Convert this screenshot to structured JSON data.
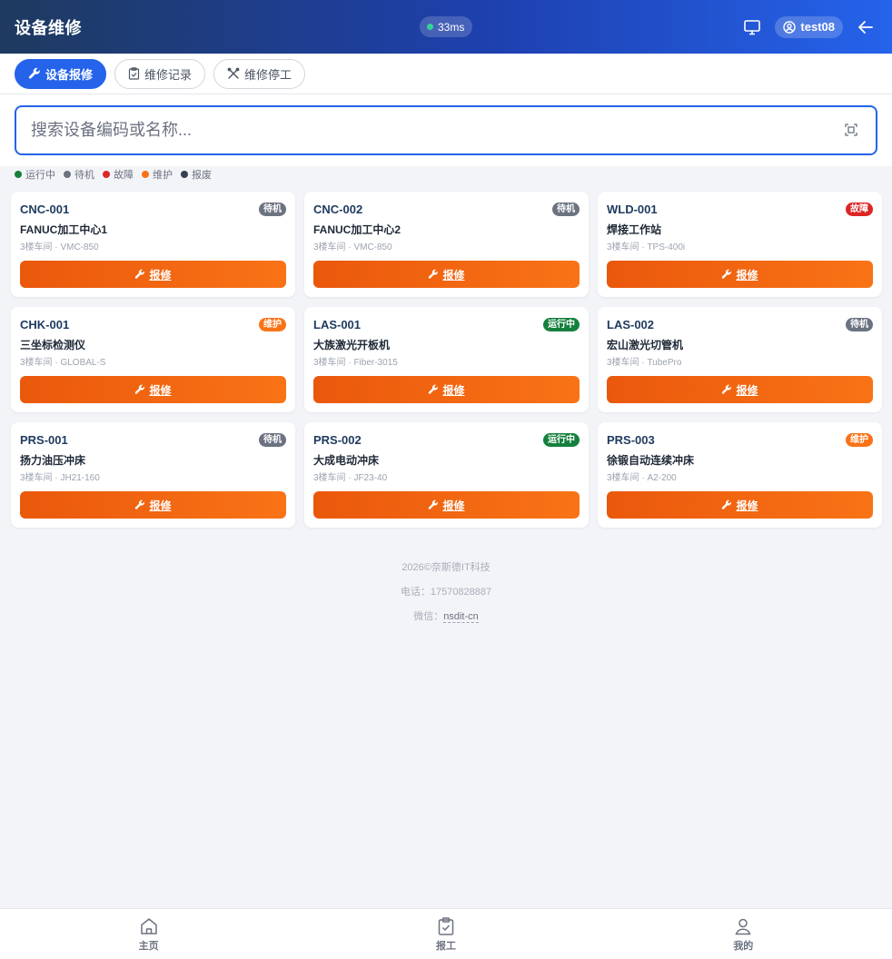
{
  "header": {
    "title": "设备维修",
    "latency": "33ms",
    "username": "test08"
  },
  "tabs": [
    {
      "label": "设备报修",
      "active": true,
      "icon": "wrench-icon"
    },
    {
      "label": "维修记录",
      "active": false,
      "icon": "clipboard-icon"
    },
    {
      "label": "维修停工",
      "active": false,
      "icon": "tools-icon"
    }
  ],
  "search": {
    "placeholder": "搜索设备编码或名称..."
  },
  "legend": [
    {
      "label": "运行中",
      "color": "#15803d"
    },
    {
      "label": "待机",
      "color": "#6b7280"
    },
    {
      "label": "故障",
      "color": "#dc2626"
    },
    {
      "label": "维护",
      "color": "#f97316"
    },
    {
      "label": "报废",
      "color": "#374151"
    }
  ],
  "repair_label": "报修",
  "devices": [
    {
      "code": "CNC-001",
      "status": "待机",
      "status_color": "#6b7280",
      "name": "FANUC加工中心1",
      "meta": "3楼车间 · VMC-850"
    },
    {
      "code": "CNC-002",
      "status": "待机",
      "status_color": "#6b7280",
      "name": "FANUC加工中心2",
      "meta": "3楼车间 · VMC-850"
    },
    {
      "code": "WLD-001",
      "status": "故障",
      "status_color": "#dc2626",
      "name": "焊接工作站",
      "meta": "3楼车间 · TPS-400i"
    },
    {
      "code": "CHK-001",
      "status": "维护",
      "status_color": "#f97316",
      "name": "三坐标检测仪",
      "meta": "3楼车间 · GLOBAL-S"
    },
    {
      "code": "LAS-001",
      "status": "运行中",
      "status_color": "#15803d",
      "name": "大族激光开板机",
      "meta": "3楼车间 · Fiber-3015"
    },
    {
      "code": "LAS-002",
      "status": "待机",
      "status_color": "#6b7280",
      "name": "宏山激光切管机",
      "meta": "3楼车间 · TubePro"
    },
    {
      "code": "PRS-001",
      "status": "待机",
      "status_color": "#6b7280",
      "name": "扬力油压冲床",
      "meta": "3楼车间 · JH21-160"
    },
    {
      "code": "PRS-002",
      "status": "运行中",
      "status_color": "#15803d",
      "name": "大成电动冲床",
      "meta": "3楼车间 · JF23-40"
    },
    {
      "code": "PRS-003",
      "status": "维护",
      "status_color": "#f97316",
      "name": "徐锻自动连续冲床",
      "meta": "3楼车间 · A2-200"
    }
  ],
  "footer": {
    "copyright": "2026©奈斯德IT科技",
    "phone": "电话：17570828887",
    "wechat_label": "微信：",
    "wechat_id": "nsdit-cn"
  },
  "bottom_nav": [
    {
      "label": "主页",
      "icon": "home-icon"
    },
    {
      "label": "报工",
      "icon": "clipboard-check-icon"
    },
    {
      "label": "我的",
      "icon": "user-icon"
    }
  ]
}
